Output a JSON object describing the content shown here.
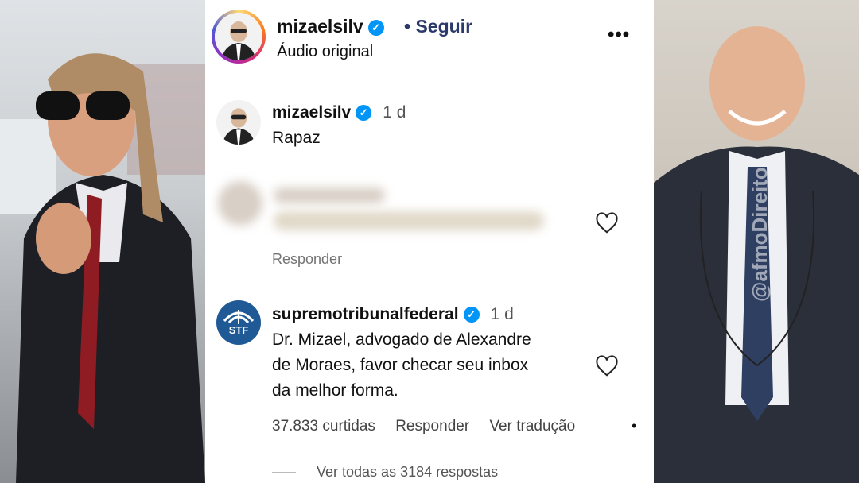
{
  "header": {
    "username": "mizaelsilv",
    "follow_label": "Seguir",
    "audio_label": "Áudio original",
    "more_icon": "more-horizontal-icon"
  },
  "comments": [
    {
      "username": "mizaelsilv",
      "time": "1 d",
      "text": "Rapaz"
    },
    {
      "reply_label": "Responder"
    },
    {
      "username": "supremotribunalfederal",
      "time": "1 d",
      "text_lines": [
        "Dr. Mizael, advogado de Alexandre",
        "de Moraes, favor checar seu inbox",
        "da melhor forma."
      ],
      "avatar_label": "STF",
      "likes": "37.833 curtidas",
      "reply_label": "Responder",
      "translate_label": "Ver tradução"
    }
  ],
  "view_all": "Ver todas as 3184 respostas",
  "watermark": "@afmoDireito",
  "colors": {
    "verified": "#0095f6",
    "follow": "#2b3a6b",
    "stf": "#1f5a96"
  }
}
